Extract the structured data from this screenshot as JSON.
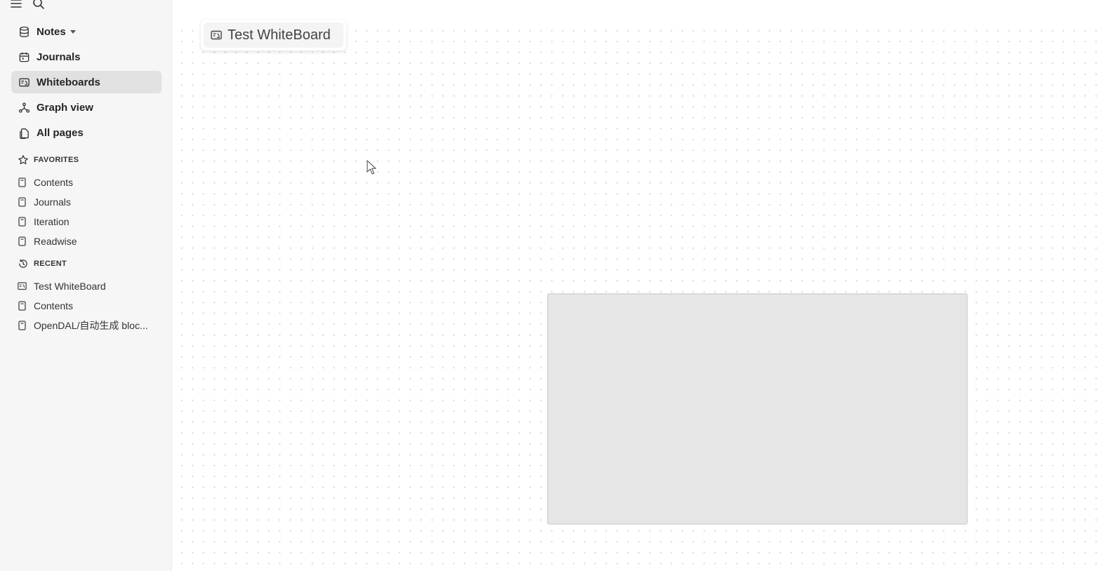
{
  "sidebar": {
    "top_icons": [
      "menu-icon",
      "search-icon"
    ],
    "nav": [
      {
        "label": "Notes",
        "icon": "database-icon",
        "has_dropdown": true
      },
      {
        "label": "Journals",
        "icon": "calendar-icon"
      },
      {
        "label": "Whiteboards",
        "icon": "whiteboard-icon",
        "active": true
      },
      {
        "label": "Graph view",
        "icon": "graph-icon"
      },
      {
        "label": "All pages",
        "icon": "pages-icon"
      }
    ],
    "favorites": {
      "heading": "FAVORITES",
      "items": [
        "Contents",
        "Journals",
        "Iteration",
        "Readwise"
      ]
    },
    "recent": {
      "heading": "RECENT",
      "items": [
        {
          "label": "Test WhiteBoard",
          "icon": "whiteboard-icon"
        },
        {
          "label": "Contents",
          "icon": "page-icon"
        },
        {
          "label": "OpenDAL/自动生成 bloc...",
          "icon": "page-icon"
        }
      ]
    }
  },
  "canvas": {
    "title": "Test WhiteBoard",
    "title_icon": "whiteboard-icon",
    "shape_fill": "#e6e6e6"
  },
  "colors": {
    "sidebar_bg": "#f6f6f6",
    "active_bg": "#e1e1e1",
    "text": "#262626"
  }
}
